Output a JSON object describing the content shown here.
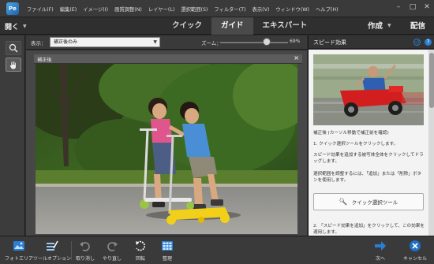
{
  "app": {
    "logo_text": "Pe"
  },
  "menu": [
    "ファイル(F)",
    "編集(E)",
    "イメージ(I)",
    "画質調整(N)",
    "レイヤー(L)",
    "選択範囲(S)",
    "フィルター(T)",
    "表示(V)",
    "ウィンドウ(W)",
    "ヘルプ(H)"
  ],
  "modebar": {
    "open_label": "開く",
    "tabs": [
      {
        "label": "クイック",
        "active": false
      },
      {
        "label": "ガイド",
        "active": true
      },
      {
        "label": "エキスパート",
        "active": false
      }
    ],
    "create_label": "作成",
    "share_label": "配信"
  },
  "options": {
    "view_label": "表示：",
    "view_value": "補正後のみ",
    "zoom_label": "ズーム：",
    "zoom_value": "69%",
    "zoom_level": 0.69
  },
  "document": {
    "tab_label": "補正後"
  },
  "panel": {
    "title": "スピード効果",
    "subtitle": "補正後 (カーソル移動で補正前を確認)",
    "step1": "1. クイック選択ツールをクリックします。",
    "desc1": "スピード効果を追加する被写体全体をクリックしてドラッグします。",
    "desc2": "選択範囲を調整するには、「追加」または「削除」ボタンを使用します。",
    "quick_select_button": "クイック選択ツール",
    "step2": "2. 「スピード効果を追加」をクリックして、この効果を適用します。"
  },
  "bottom": {
    "photo_area": "フォトエリア",
    "tool_options": "ツールオプション",
    "undo": "取り消し",
    "redo": "やり直し",
    "rotate": "回転",
    "organize": "整理",
    "next": "次へ",
    "cancel": "キャンセル"
  },
  "colors": {
    "accent_blue": "#2a7fd4",
    "cancel_blue": "#1f6fc4",
    "panel_bg": "#f3f3f3"
  }
}
